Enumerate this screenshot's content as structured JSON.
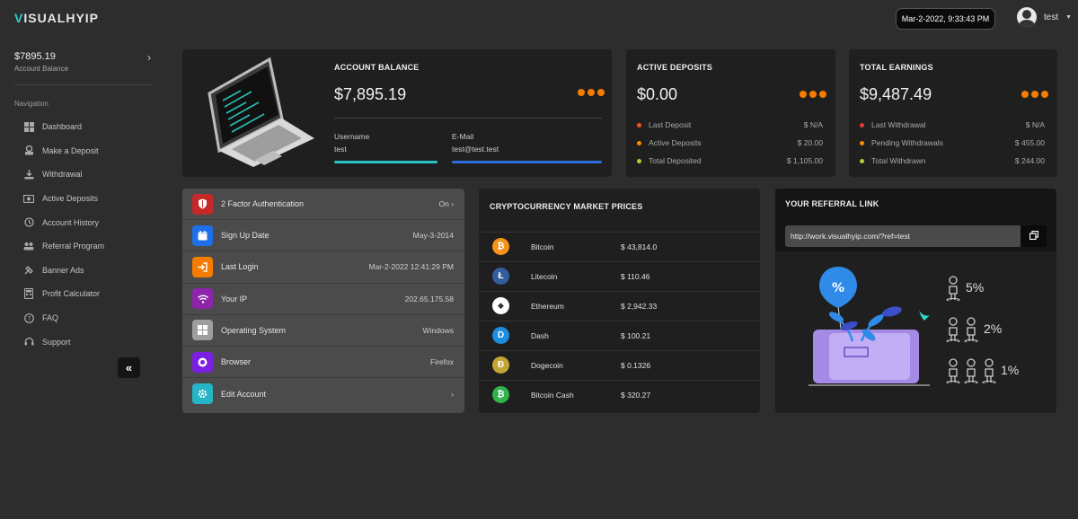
{
  "app": {
    "logo": "VISUALHYIP",
    "datetime": "Mar-2-2022, 9:33:43 PM",
    "user_name": "test"
  },
  "sidebar": {
    "balance_amount": "$7895.19",
    "balance_label": "Account Balance",
    "nav_title": "Navigation",
    "items": [
      {
        "label": "Dashboard",
        "icon": "grid-icon"
      },
      {
        "label": "Make a Deposit",
        "icon": "deposit-icon"
      },
      {
        "label": "Withdrawal",
        "icon": "withdrawal-icon"
      },
      {
        "label": "Active Deposits",
        "icon": "cash-icon"
      },
      {
        "label": "Account History",
        "icon": "history-icon"
      },
      {
        "label": "Referral Program",
        "icon": "referral-icon"
      },
      {
        "label": "Banner Ads",
        "icon": "banner-icon"
      },
      {
        "label": "Profit Calculator",
        "icon": "calculator-icon"
      },
      {
        "label": "FAQ",
        "icon": "question-icon"
      },
      {
        "label": "Support",
        "icon": "headset-icon"
      }
    ],
    "collapse_glyph": "«"
  },
  "account_balance": {
    "title": "ACCOUNT BALANCE",
    "amount": "$7,895.19",
    "username_label": "Username",
    "username": "test",
    "email_label": "E-Mail",
    "email": "test@test.test"
  },
  "active_deposits": {
    "title": "ACTIVE DEPOSITS",
    "amount": "$0.00",
    "rows": [
      {
        "label": "Last Deposit",
        "value": "$ N/A",
        "color": "#f4511e"
      },
      {
        "label": "Active Deposits",
        "value": "$ 20.00",
        "color": "#fb8c00"
      },
      {
        "label": "Total Deposited",
        "value": "$ 1,105.00",
        "color": "#c0ca33"
      }
    ]
  },
  "total_earnings": {
    "title": "TOTAL EARNINGS",
    "amount": "$9,487.49",
    "rows": [
      {
        "label": "Last Withdrawal",
        "value": "$ N/A",
        "color": "#e53935"
      },
      {
        "label": "Pending Withdrawals",
        "value": "$ 455.00",
        "color": "#fb8c00"
      },
      {
        "label": "Total Withdrawn",
        "value": "$ 244.00",
        "color": "#c0ca33"
      }
    ]
  },
  "info_list": [
    {
      "label": "2 Factor Authentication",
      "value": "On ›",
      "icon": "shield-icon",
      "color": "#c62828"
    },
    {
      "label": "Sign Up Date",
      "value": "May-3-2014",
      "icon": "calendar-icon",
      "color": "#1e6fe8"
    },
    {
      "label": "Last Login",
      "value": "Mar-2-2022 12:41:29 PM",
      "icon": "login-icon",
      "color": "#f57c00"
    },
    {
      "label": "Your IP",
      "value": "202.65.175.58",
      "icon": "wifi-icon",
      "color": "#8e24aa"
    },
    {
      "label": "Operating System",
      "value": "Windows",
      "icon": "windows-icon",
      "color": "#9e9e9e"
    },
    {
      "label": "Browser",
      "value": "Firefox",
      "icon": "browser-icon",
      "color": "#7b1fe0"
    },
    {
      "label": "Edit Account",
      "value": "›",
      "icon": "gear-icon",
      "color": "#26b5c6"
    }
  ],
  "crypto": {
    "title": "CRYPTOCURRENCY MARKET PRICES",
    "rows": [
      {
        "name": "Bitcoin",
        "price": "$ 43,814.0",
        "change": "",
        "icon": "bitcoin-icon",
        "glyph": "₿",
        "color": "#f7931a",
        "change_color": "#e53935"
      },
      {
        "name": "Litecoin",
        "price": "$ 110.46",
        "change": "",
        "icon": "litecoin-icon",
        "glyph": "Ł",
        "color": "#345d9d",
        "change_color": "#e53935"
      },
      {
        "name": "Ethereum",
        "price": "$ 2,942.33",
        "change": "",
        "icon": "ethereum-icon",
        "glyph": "◆",
        "color": "#ffffff",
        "change_color": "#e53935"
      },
      {
        "name": "Dash",
        "price": "$ 100.21",
        "change": "",
        "icon": "dash-icon",
        "glyph": "D",
        "color": "#1c8de0",
        "change_color": "#43a047"
      },
      {
        "name": "Dogecoin",
        "price": "$ 0.1326",
        "change": "",
        "icon": "dogecoin-icon",
        "glyph": "Ð",
        "color": "#c2a633",
        "change_color": "#e53935"
      },
      {
        "name": "Bitcoin Cash",
        "price": "$ 320.27",
        "change": "",
        "icon": "bitcoin-cash-icon",
        "glyph": "₿",
        "color": "#2fb34a",
        "change_color": "#e53935"
      }
    ]
  },
  "referral": {
    "title": "YOUR REFERRAL LINK",
    "link": "http://work.visualhyip.com/?ref=test",
    "tiers": [
      {
        "percent": "5%",
        "people": 1
      },
      {
        "percent": "2%",
        "people": 2
      },
      {
        "percent": "1%",
        "people": 3
      }
    ]
  }
}
